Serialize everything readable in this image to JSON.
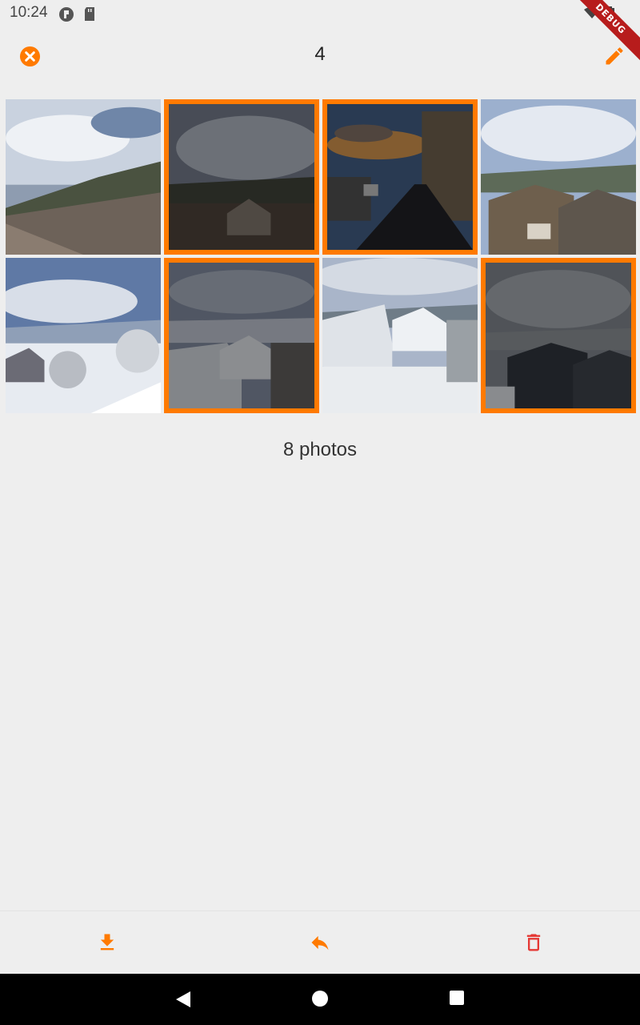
{
  "status_bar": {
    "time": "10:24",
    "debug_label": "DEBUG"
  },
  "app_bar": {
    "selected_count": "4"
  },
  "grid": {
    "photos": [
      {
        "selected": false,
        "scene": "cloudy mountain view over stone roofs"
      },
      {
        "selected": true,
        "scene": "storm clouds over valley"
      },
      {
        "selected": true,
        "scene": "village street at dusk"
      },
      {
        "selected": false,
        "scene": "stone houses with mountains"
      },
      {
        "selected": false,
        "scene": "snowy village with frosted trees"
      },
      {
        "selected": true,
        "scene": "snowy rooftops under dark sky"
      },
      {
        "selected": false,
        "scene": "snow covered village houses"
      },
      {
        "selected": true,
        "scene": "dark roofs over misty valley"
      }
    ],
    "count_label": "8 photos"
  },
  "colors": {
    "accent": "#ff7a00",
    "delete": "#e53935",
    "background": "#eeeeee"
  },
  "actions": [
    {
      "name": "download",
      "icon": "download-icon"
    },
    {
      "name": "share",
      "icon": "reply-icon"
    },
    {
      "name": "delete",
      "icon": "trash-icon"
    }
  ]
}
